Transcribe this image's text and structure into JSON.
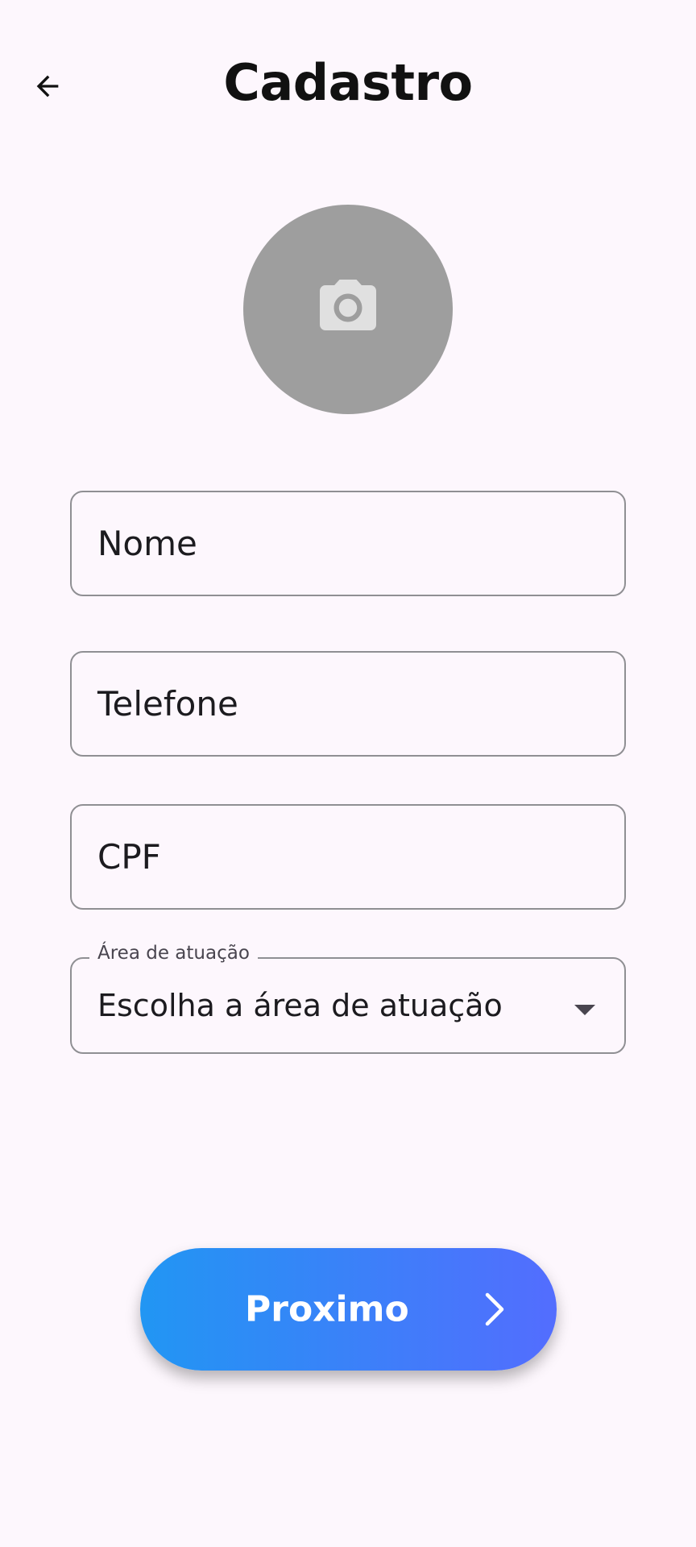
{
  "header": {
    "title": "Cadastro",
    "back_icon": "arrow-back-icon"
  },
  "avatar": {
    "icon": "camera-icon",
    "background_color": "#9e9e9e"
  },
  "form": {
    "name_placeholder": "Nome",
    "phone_placeholder": "Telefone",
    "cpf_placeholder": "CPF",
    "area": {
      "label": "Área de atuação",
      "value": "Escolha a área de atuação",
      "icon": "dropdown-arrow-icon"
    }
  },
  "next_button": {
    "label": "Proximo",
    "icon": "chevron-right-icon",
    "gradient_start": "#2196f3",
    "gradient_end": "#536dfe"
  },
  "colors": {
    "background": "#fdf7fd",
    "field_border": "#8f8f93"
  }
}
